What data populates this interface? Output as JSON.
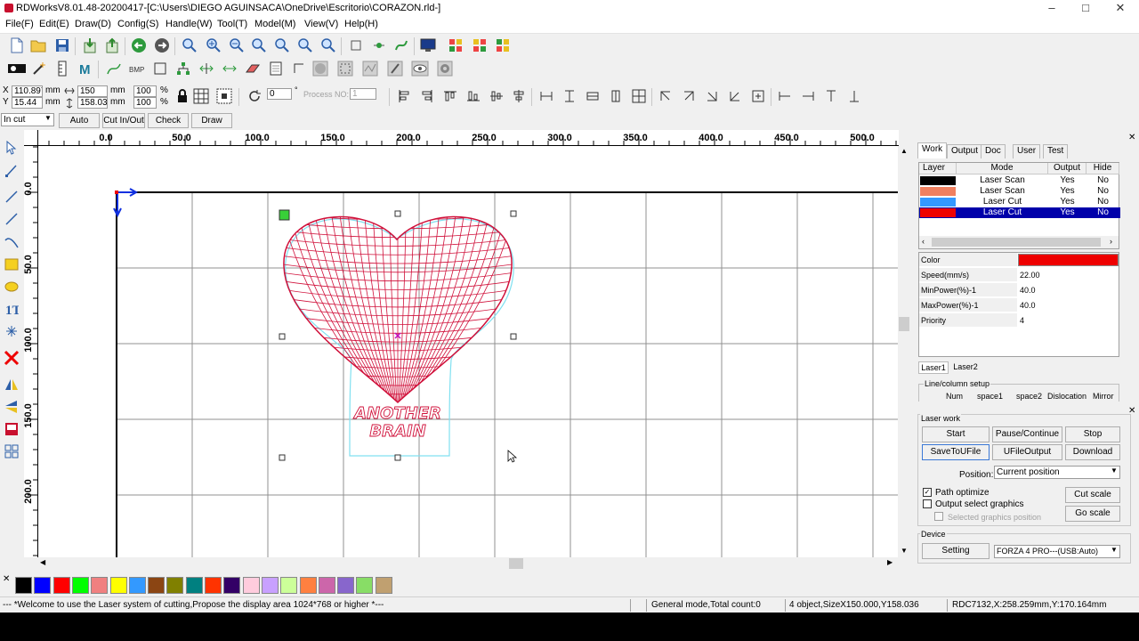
{
  "titlebar": {
    "title": "RDWorksV8.01.48-20200417-[C:\\Users\\DIEGO AGUINSACA\\OneDrive\\Escritorio\\CORAZON.rld-]"
  },
  "menu": [
    "File(F)",
    "Edit(E)",
    "Draw(D)",
    "Config(S)",
    "Handle(W)",
    "Tool(T)",
    "Model(M)",
    "View(V)",
    "Help(H)"
  ],
  "coords": {
    "x_label": "X",
    "x_value": "110.897",
    "y_label": "Y",
    "y_value": "15.44",
    "unit": "mm",
    "w_value": "150",
    "h_value": "158.036",
    "w_pct": "100",
    "h_pct": "100",
    "pct": "%",
    "angle": "0",
    "process_no_label": "Process NO:",
    "process_no": "1"
  },
  "mode_bar": {
    "select": "In cut",
    "auto": "Auto",
    "cutinout": "Cut In/Out",
    "check": "Check",
    "draw": "Draw"
  },
  "ruler": {
    "h_ticks": [
      "0.0",
      "50.0",
      "100.0",
      "150.0",
      "200.0",
      "250.0",
      "300.0",
      "350.0",
      "400.0",
      "450.0",
      "500.0"
    ],
    "v_ticks": [
      "0.0",
      "50.0",
      "100.0",
      "150.0",
      "200.0"
    ]
  },
  "artwork": {
    "text_line1": "ANOTHER",
    "text_line2": "BRAIN"
  },
  "panel": {
    "tabs": [
      "Work",
      "Output",
      "Doc",
      "User",
      "Test"
    ],
    "headers": [
      "Layer",
      "Mode",
      "Output",
      "Hide"
    ],
    "layers": [
      {
        "color": "#000000",
        "mode": "Laser Scan",
        "output": "Yes",
        "hide": "No"
      },
      {
        "color": "#f08060",
        "mode": "Laser Scan",
        "output": "Yes",
        "hide": "No"
      },
      {
        "color": "#3399ff",
        "mode": "Laser Cut",
        "output": "Yes",
        "hide": "No"
      },
      {
        "color": "#ee0000",
        "mode": "Laser Cut",
        "output": "Yes",
        "hide": "No"
      }
    ],
    "props": [
      {
        "k": "Color",
        "v": ""
      },
      {
        "k": "Speed(mm/s)",
        "v": "22.00"
      },
      {
        "k": "MinPower(%)-1",
        "v": "40.0"
      },
      {
        "k": "MaxPower(%)-1",
        "v": "40.0"
      },
      {
        "k": "Priority",
        "v": "4"
      }
    ],
    "laser_tabs": [
      "Laser1",
      "Laser2"
    ],
    "line_column": "Line/column setup",
    "lc_headers": [
      "Num",
      "space1",
      "space2",
      "Dislocation",
      "Mirror"
    ]
  },
  "laserwork": {
    "title": "Laser work",
    "start": "Start",
    "pause": "Pause/Continue",
    "stop": "Stop",
    "savetofile": "SaveToUFile",
    "ufileoutput": "UFileOutput",
    "download": "Download",
    "position_label": "Position:",
    "position_value": "Current position",
    "path_optimize": "Path optimize",
    "output_select": "Output select graphics",
    "selected_pos": "Selected graphics position",
    "cut_scale": "Cut scale",
    "go_scale": "Go scale",
    "device_label": "Device",
    "setting": "Setting",
    "device_value": "FORZA 4 PRO---(USB:Auto)"
  },
  "palette": [
    "#000000",
    "#0000ff",
    "#ff0000",
    "#00ff00",
    "#f08080",
    "#ffff00",
    "#3399ff",
    "#8b4513",
    "#808000",
    "#008080",
    "#ff3300",
    "#330066",
    "#ffccdd",
    "#c8a0ff",
    "#ccff99",
    "#ff8040",
    "#cc66aa",
    "#8866cc",
    "#88dd66",
    "#c0a070"
  ],
  "status": {
    "welcome": "--- *Welcome to use the Laser system of cutting,Propose the display area 1024*768 or higher *---",
    "mode": "General mode,Total count:0",
    "objects": "4 object,SizeX150.000,Y158.036",
    "position": "RDC7132,X:258.259mm,Y:170.164mm"
  },
  "colors": {
    "accent_select": "#0000aa",
    "layer_red": "#ee0000",
    "grid": "#909090"
  }
}
